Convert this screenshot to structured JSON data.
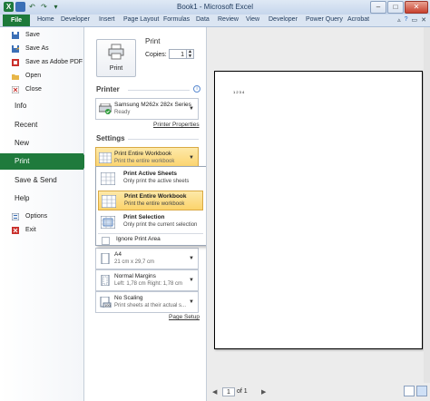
{
  "window": {
    "title": "Book1 - Microsoft Excel",
    "controls": {
      "minimize": "–",
      "maximize": "□",
      "close": "✕"
    }
  },
  "ribbon": {
    "file_tab": "File",
    "tabs": [
      "Home",
      "Developer",
      "Insert",
      "Page Layout",
      "Formulas",
      "Data",
      "Review",
      "View",
      "Developer",
      "Power Query",
      "Acrobat"
    ]
  },
  "backstage": {
    "items": [
      {
        "label": "Save",
        "icon": "save-icon"
      },
      {
        "label": "Save As",
        "icon": "save-as-icon"
      },
      {
        "label": "Save as Adobe PDF",
        "icon": "pdf-icon"
      },
      {
        "label": "Open",
        "icon": "folder-open-icon"
      },
      {
        "label": "Close",
        "icon": "close-file-icon"
      }
    ],
    "headers": [
      "Info",
      "Recent",
      "New",
      "Print",
      "Save & Send",
      "Help"
    ],
    "bottom_items": [
      {
        "label": "Options",
        "icon": "options-icon"
      },
      {
        "label": "Exit",
        "icon": "exit-icon"
      }
    ]
  },
  "print": {
    "title": "Print",
    "button": "Print",
    "copies_label": "Copies:",
    "copies_value": "1"
  },
  "printer": {
    "header": "Printer",
    "name": "Samsung M262x 282x Series",
    "status": "Ready",
    "properties_link": "Printer Properties"
  },
  "settings": {
    "header": "Settings",
    "scope": {
      "title": "Print Entire Workbook",
      "subtitle": "Print the entire workbook"
    },
    "popup": [
      {
        "title": "Print Active Sheets",
        "subtitle": "Only print the active sheets",
        "selected": false
      },
      {
        "title": "Print Entire Workbook",
        "subtitle": "Print the entire workbook",
        "selected": true
      },
      {
        "title": "Print Selection",
        "subtitle": "Only print the current selection",
        "selected": false
      }
    ],
    "ignore_print_area": "Ignore Print Area",
    "paper": {
      "title": "A4",
      "subtitle": "21 cm x 29,7 cm"
    },
    "margins": {
      "title": "Normal Margins",
      "subtitle": "Left: 1,78 cm   Right: 1,78 cm"
    },
    "scaling": {
      "title": "No Scaling",
      "subtitle": "Print sheets at their actual s..."
    },
    "page_setup_link": "Page Setup"
  },
  "preview": {
    "page_text": "1 2 3 4 ",
    "page_number": "1",
    "page_of": "of 1"
  },
  "colors": {
    "file_green": "#1f7a3c",
    "selection_yellow": "#fbd36b"
  }
}
